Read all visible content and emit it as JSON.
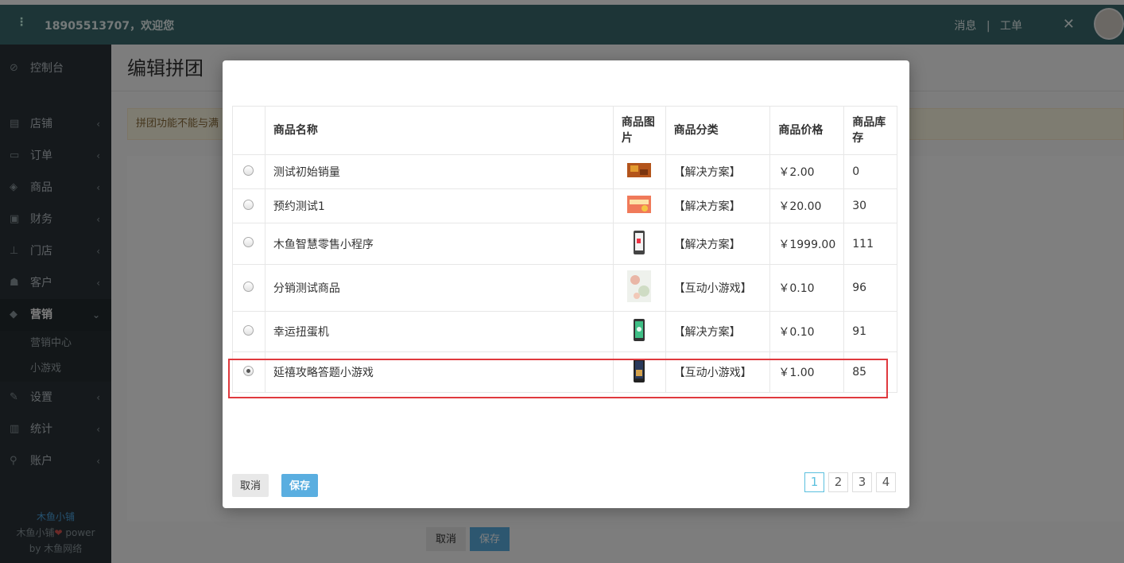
{
  "topbar": {
    "menu_icon": "⋮",
    "welcome": "18905513707，欢迎您",
    "link_messages": "消息",
    "link_separator": "|",
    "link_tickets": "工单",
    "tools_icon": "✕"
  },
  "sidebar": {
    "items": [
      {
        "label": "控制台",
        "icon": "⊘"
      },
      {
        "label": "店铺",
        "icon": "▤"
      },
      {
        "label": "订单",
        "icon": "▭"
      },
      {
        "label": "商品",
        "icon": "◈"
      },
      {
        "label": "财务",
        "icon": "▣"
      },
      {
        "label": "门店",
        "icon": "⊥"
      },
      {
        "label": "客户",
        "icon": "☗"
      },
      {
        "label": "营销",
        "icon": "◆"
      },
      {
        "label": "设置",
        "icon": "✎"
      },
      {
        "label": "统计",
        "icon": "▥"
      },
      {
        "label": "账户",
        "icon": "⚲"
      }
    ],
    "sub_items": [
      "营销中心",
      "小游戏"
    ],
    "footer_brand": "木鱼小铺",
    "footer_line2": "木鱼小铺",
    "footer_heart": "❤",
    "footer_power": "power",
    "footer_line3": "by 木鱼网络"
  },
  "page": {
    "title": "编辑拼团",
    "notice": "拼团功能不能与满",
    "cancel": "取消",
    "save": "保存"
  },
  "modal": {
    "columns": [
      "",
      "商品名称",
      "商品图片",
      "商品分类",
      "商品价格",
      "商品库存"
    ],
    "rows": [
      {
        "name": "测试初始销量",
        "category": "【解决方案】",
        "price": "￥2.00",
        "stock": "0",
        "selected": false,
        "thumb": "autumn"
      },
      {
        "name": "预约测试1",
        "category": "【解决方案】",
        "price": "￥20.00",
        "stock": "30",
        "selected": false,
        "thumb": "banner"
      },
      {
        "name": "木鱼智慧零售小程序",
        "category": "【解决方案】",
        "price": "￥1999.00",
        "stock": "111",
        "selected": false,
        "thumb": "phone-white"
      },
      {
        "name": "分销测试商品",
        "category": "【互动小游戏】",
        "price": "￥0.10",
        "stock": "96",
        "selected": false,
        "thumb": "floral"
      },
      {
        "name": "幸运扭蛋机",
        "category": "【解决方案】",
        "price": "￥0.10",
        "stock": "91",
        "selected": false,
        "thumb": "phone-green"
      },
      {
        "name": "延禧攻略答题小游戏",
        "category": "【互动小游戏】",
        "price": "￥1.00",
        "stock": "85",
        "selected": true,
        "thumb": "phone-dark"
      }
    ],
    "cancel": "取消",
    "save": "保存",
    "pages": [
      "1",
      "2",
      "3",
      "4"
    ],
    "current_page": "1"
  },
  "colors": {
    "topbar": "#3b6b6e",
    "sidebar": "#2b3338",
    "save_button": "#5aaee0",
    "highlight": "#e0393e",
    "pager_active": "#5bc0de"
  }
}
